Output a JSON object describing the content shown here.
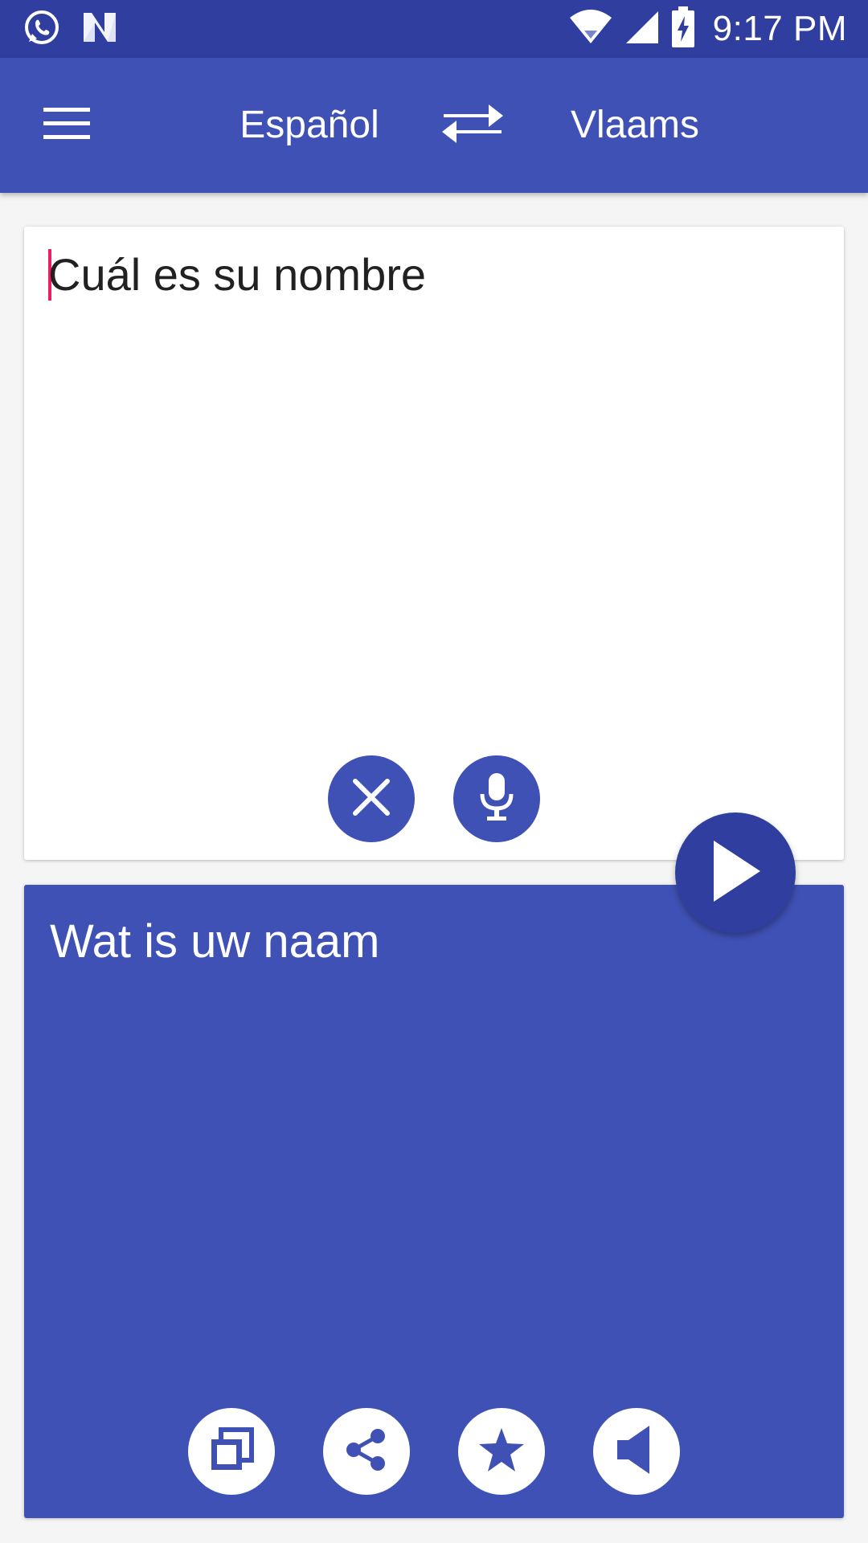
{
  "status_bar": {
    "time": "9:17 PM",
    "icons": [
      "whatsapp-icon",
      "n-app-icon",
      "wifi-icon",
      "cell-signal-icon",
      "battery-charging-icon"
    ]
  },
  "app_bar": {
    "menu_icon": "hamburger-menu-icon",
    "source_language": "Español",
    "swap_icon": "swap-arrows-icon",
    "target_language": "Vlaams"
  },
  "input": {
    "text": "Cuál es su nombre",
    "clear_icon": "close-icon",
    "mic_icon": "microphone-icon"
  },
  "translate_button": {
    "icon": "play-icon"
  },
  "output": {
    "text": "Wat is uw naam",
    "actions": [
      "copy-icon",
      "share-icon",
      "star-icon",
      "volume-icon"
    ]
  },
  "colors": {
    "primary": "#3f51b5",
    "primary_dark": "#303f9f",
    "accent": "#e91e63",
    "card_bg": "#ffffff",
    "page_bg": "#f5f5f5"
  }
}
